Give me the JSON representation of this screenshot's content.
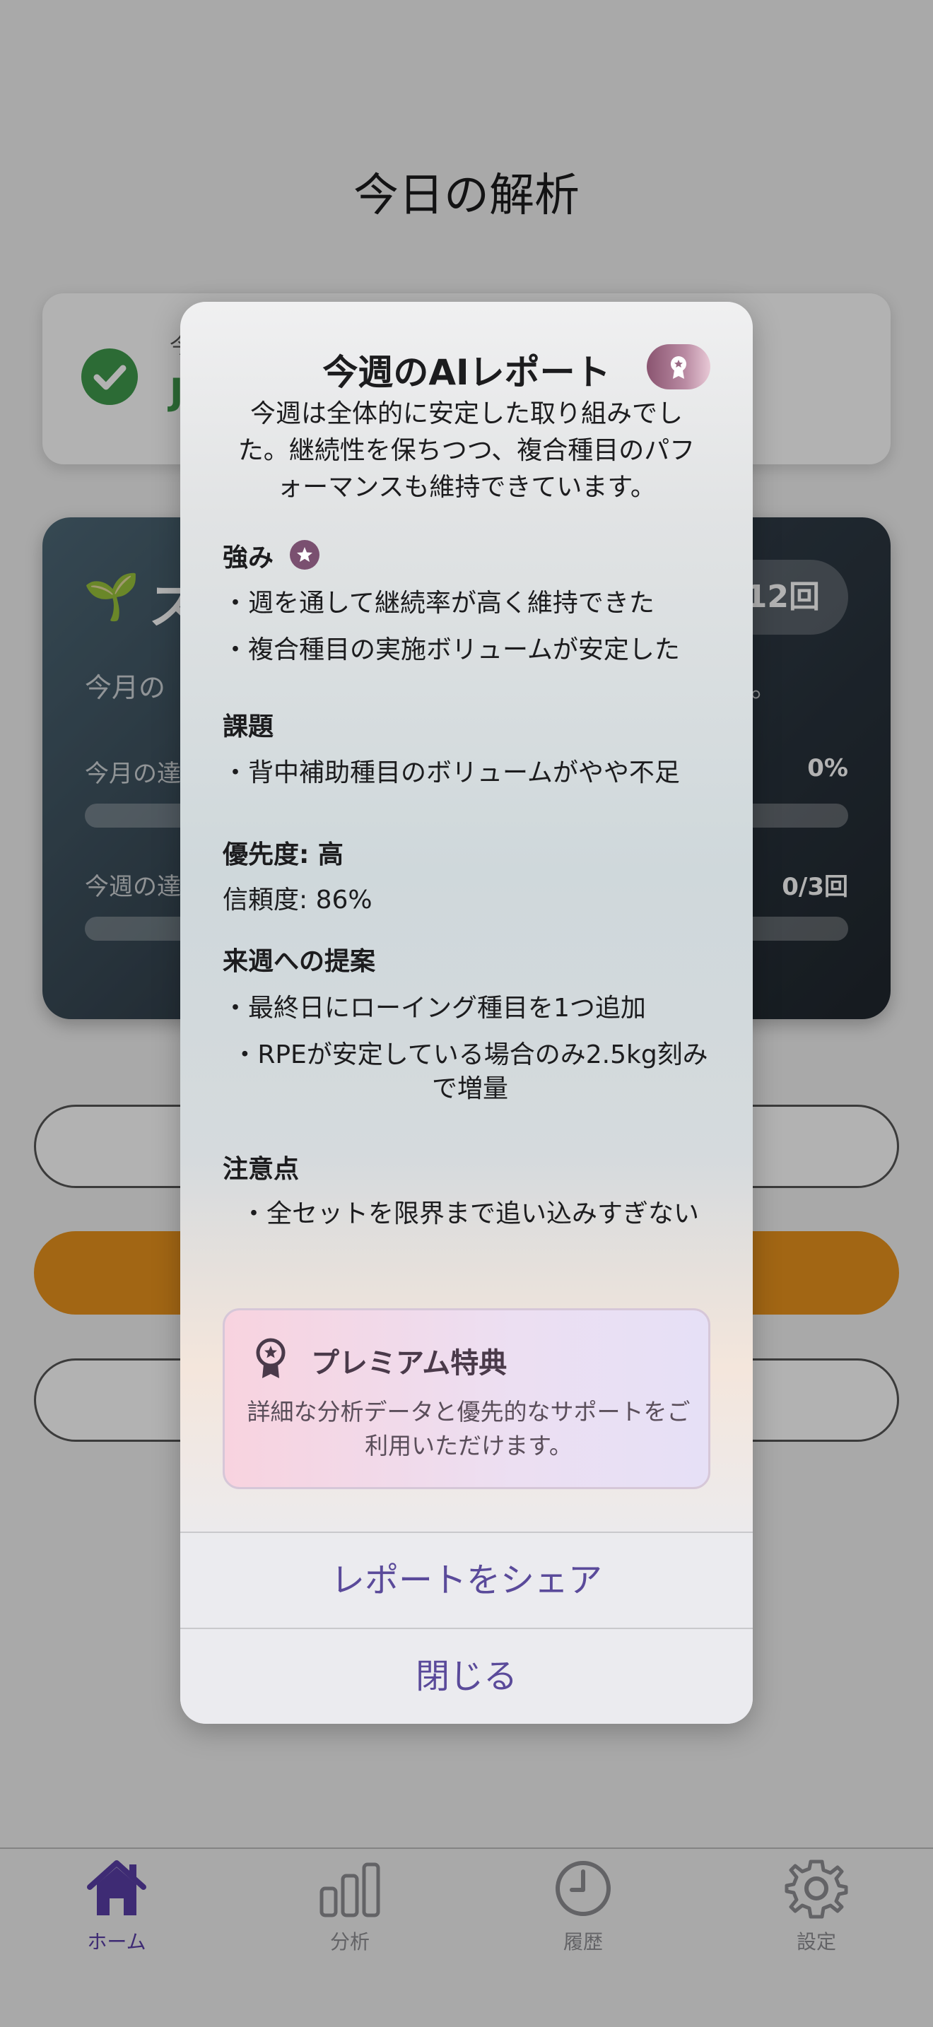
{
  "page": {
    "title": "今日の解析"
  },
  "status_card": {
    "small_text": "今",
    "big_text": "J"
  },
  "plan_card": {
    "sprout": "🌱",
    "name": "ス",
    "pill": "12回",
    "desc_start": "今月の",
    "desc_end": "。",
    "month_label": "今月の達",
    "month_value": "0%",
    "month_progress": 0,
    "week_label": "今週の達",
    "week_value": "0/3回",
    "week_progress": 0
  },
  "modal": {
    "title": "今週のAIレポート",
    "badge_icon": "award-icon",
    "summary": "今週は全体的に安定した取り組みでした。継続性を保ちつつ、複合種目のパフォーマンスも維持できています。",
    "strengths": {
      "heading": "強み",
      "items": [
        "・週を通して継続率が高く維持できた",
        "・複合種目の実施ボリュームが安定した"
      ]
    },
    "issues": {
      "heading": "課題",
      "items": [
        "・背中補助種目のボリュームがやや不足"
      ]
    },
    "priority": "優先度: 高",
    "confidence": "信頼度: 86%",
    "suggestions": {
      "heading": "来週への提案",
      "items": [
        "・最終日にローイング種目を1つ追加",
        "・RPEが安定している場合のみ2.5kg刻みで増量"
      ]
    },
    "cautions": {
      "heading": "注意点",
      "items": [
        "・全セットを限界まで追い込みすぎない"
      ]
    },
    "premium": {
      "title": "プレミアム特典",
      "description": "詳細な分析データと優先的なサポートをご利用いただけます。"
    },
    "share_label": "レポートをシェア",
    "close_label": "閉じる"
  },
  "tabbar": {
    "tabs": [
      {
        "label": "ホーム",
        "icon": "home-icon",
        "active": true
      },
      {
        "label": "分析",
        "icon": "chart-icon",
        "active": false
      },
      {
        "label": "履歴",
        "icon": "clock-icon",
        "active": false
      },
      {
        "label": "設定",
        "icon": "gear-icon",
        "active": false
      }
    ]
  },
  "colors": {
    "accent": "#5a3ea6",
    "success": "#3f9a4d",
    "orange_button": "#e8921e"
  }
}
